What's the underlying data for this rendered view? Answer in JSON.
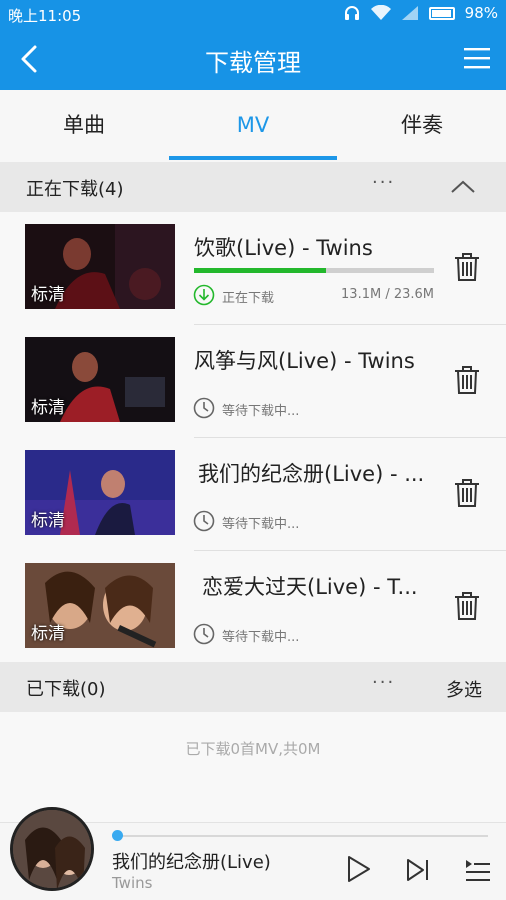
{
  "status": {
    "time": "晚上11:05",
    "battery": "98%"
  },
  "appbar": {
    "title": "下载管理"
  },
  "tabs": [
    {
      "label": "单曲"
    },
    {
      "label": "MV"
    },
    {
      "label": "伴奏"
    }
  ],
  "downloading": {
    "header": "正在下载(4)",
    "more": "···",
    "items": [
      {
        "title": "饮歌(Live) - Twins",
        "quality": "标清",
        "status": "正在下载",
        "size": "13.1M / 23.6M",
        "progress": 0.55
      },
      {
        "title": "风筝与风(Live) - Twins",
        "quality": "标清",
        "status": "等待下载中..."
      },
      {
        "title": "我们的纪念册(Live) - ...",
        "quality": "标清",
        "status": "等待下载中..."
      },
      {
        "title": "恋爱大过天(Live) - T...",
        "quality": "标清",
        "status": "等待下载中..."
      }
    ]
  },
  "downloaded": {
    "header": "已下载(0)",
    "more": "···",
    "multi_select": "多选",
    "empty_message": "已下载0首MV,共0M"
  },
  "player": {
    "title": "我们的纪念册(Live)",
    "artist": "Twins",
    "progress": 0.0
  },
  "colors": {
    "primary": "#1793e6",
    "accent": "#1d97e8",
    "progress": "#23b82c"
  }
}
